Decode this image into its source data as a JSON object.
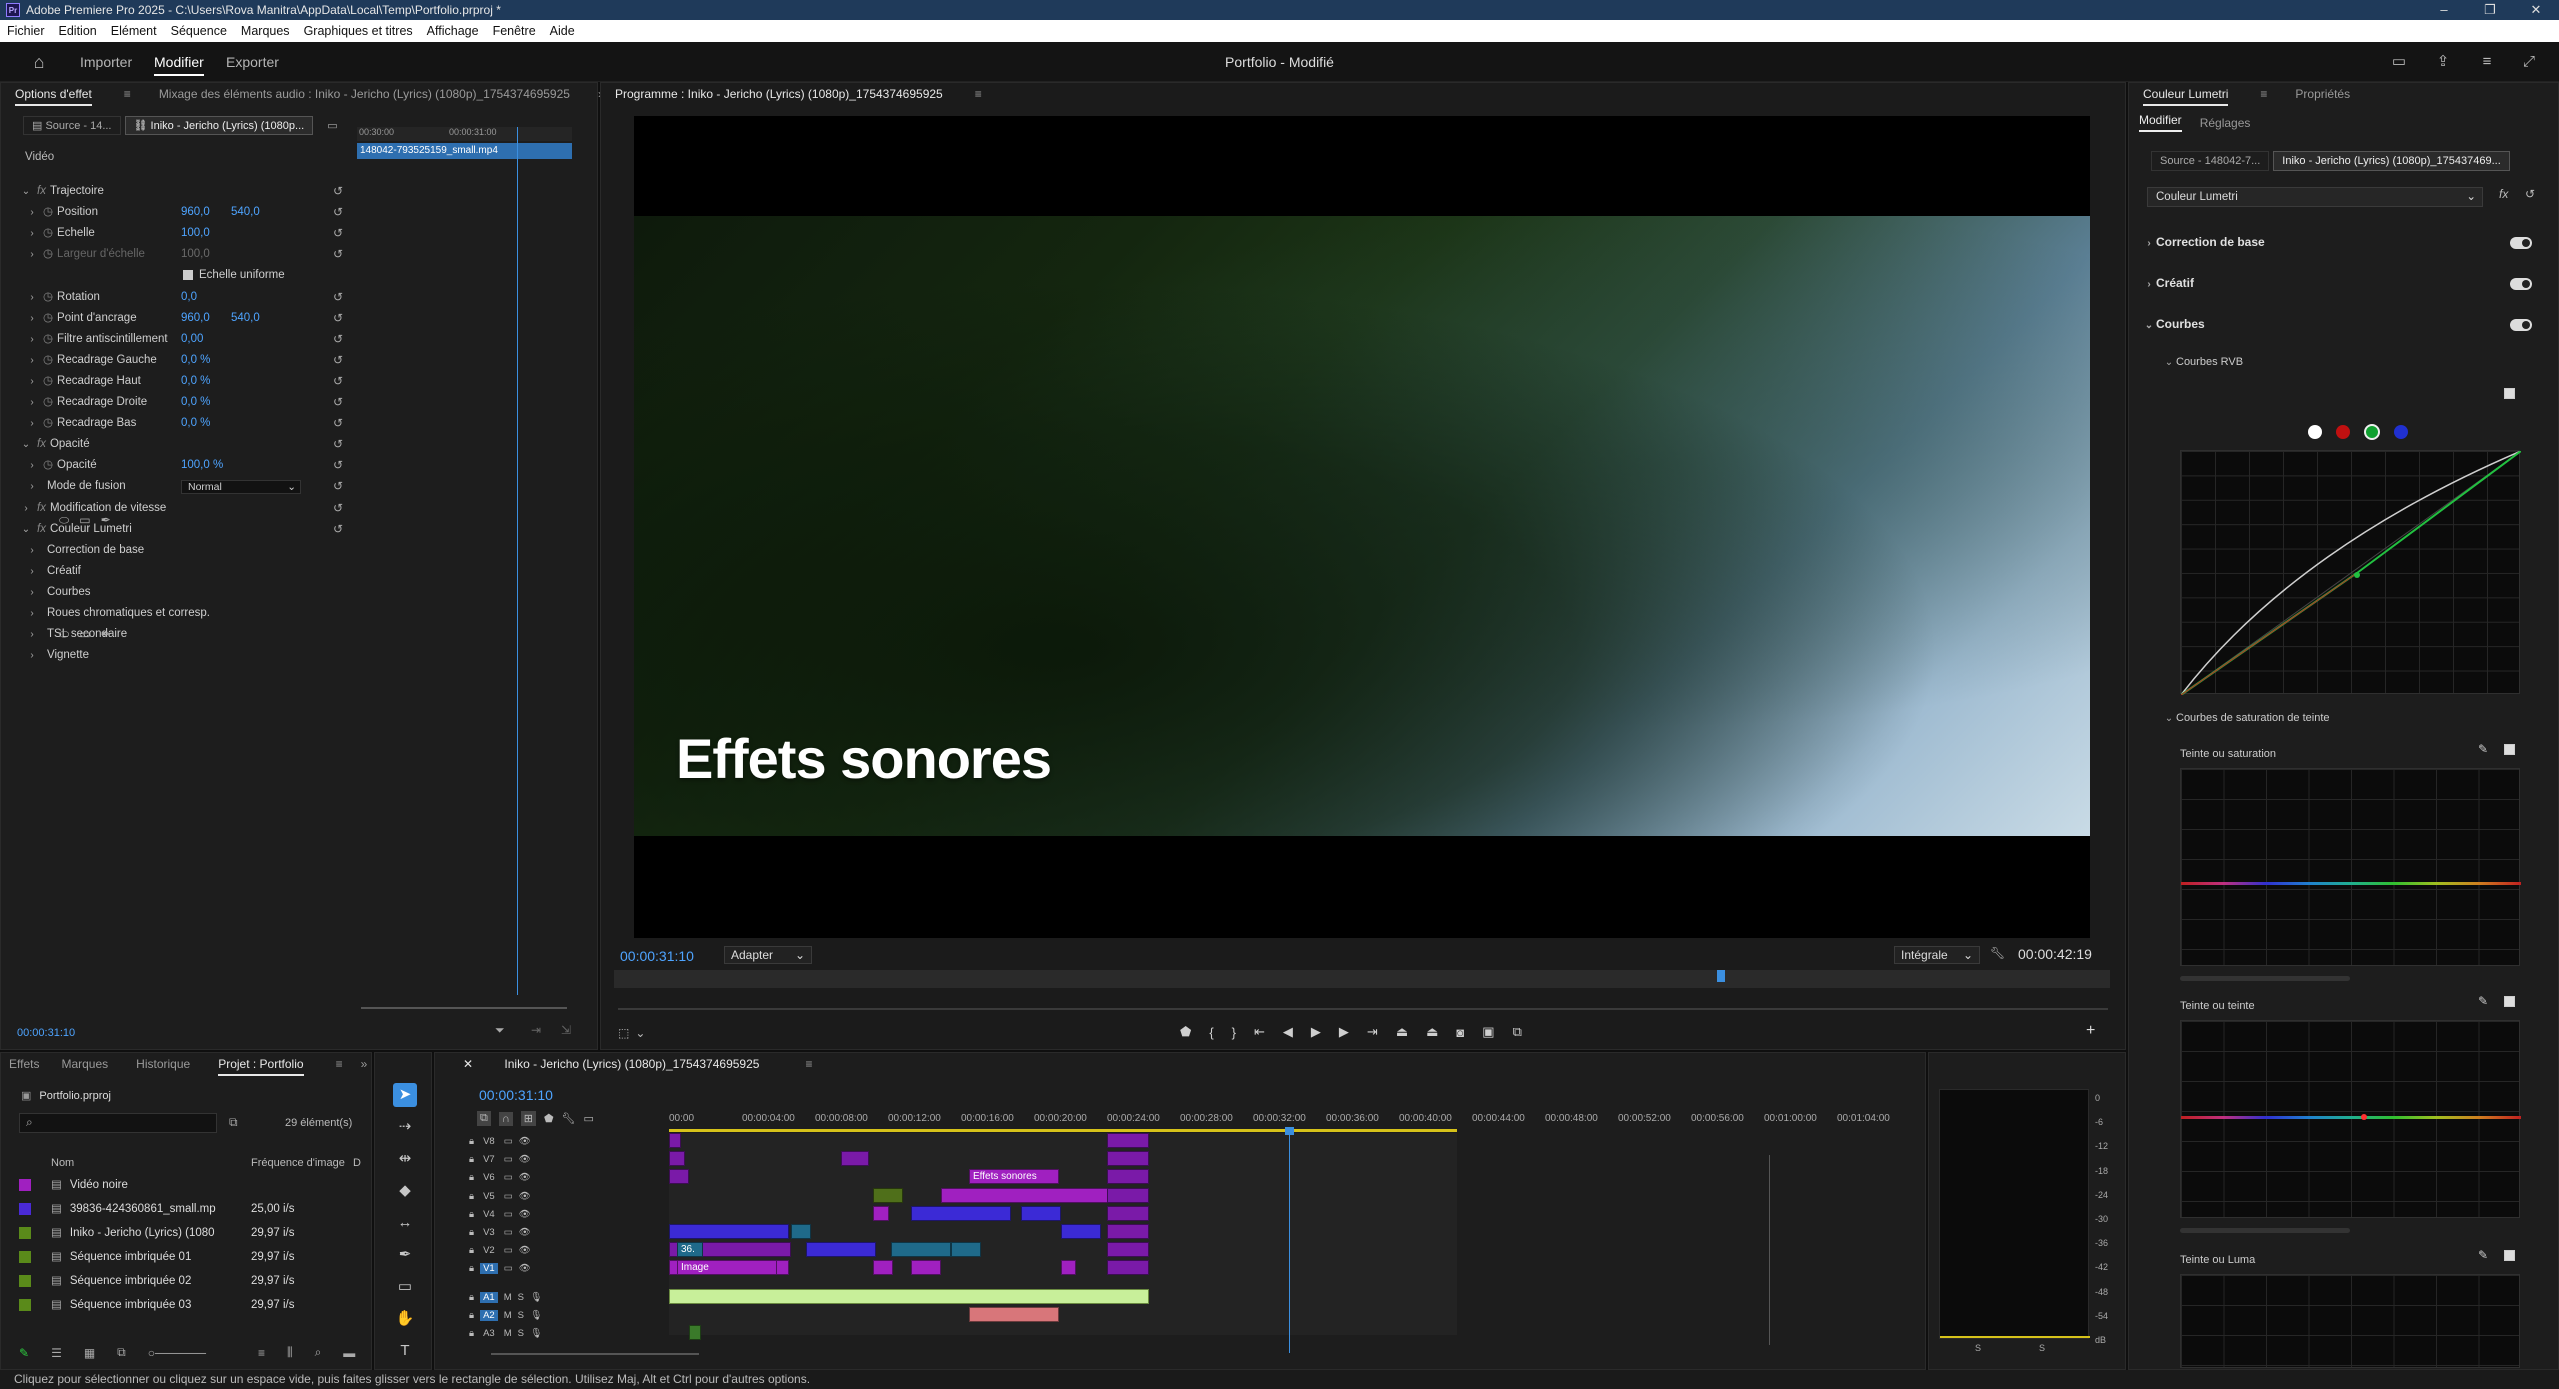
{
  "window": {
    "title": "Adobe Premiere Pro 2025 - C:\\Users\\Rova Manitra\\AppData\\Local\\Temp\\Portfolio.prproj *",
    "app_badge": "Pr"
  },
  "menu": [
    "Fichier",
    "Edition",
    "Elément",
    "Séquence",
    "Marques",
    "Graphiques et titres",
    "Affichage",
    "Fenêtre",
    "Aide"
  ],
  "header": {
    "modes": [
      "Importer",
      "Modifier",
      "Exporter"
    ],
    "active_mode": "Modifier",
    "project_title": "Portfolio - Modifié"
  },
  "effect_controls": {
    "tabs": [
      "Options d'effet",
      "Mixage des éléments audio : Iniko - Jericho (Lyrics) (1080p)_1754374695925"
    ],
    "source_tabs": [
      "Source - 14...",
      "Iniko - Jericho (Lyrics) (1080p..."
    ],
    "mini_timeline": {
      "times": [
        "00:30:00",
        "00:00:31:00"
      ],
      "clip": "148042-793525159_small.mp4"
    },
    "section_video": "Vidéo",
    "rows": [
      {
        "label": "Trajectoire",
        "fx": true,
        "expanded": true
      },
      {
        "label": "Position",
        "v1": "960,0",
        "v2": "540,0"
      },
      {
        "label": "Echelle",
        "v1": "100,0"
      },
      {
        "label": "Largeur d'échelle",
        "v1": "100,0",
        "disabled": true
      },
      {
        "label": "Echelle uniforme",
        "checkbox": true
      },
      {
        "label": "Rotation",
        "v1": "0,0"
      },
      {
        "label": "Point d'ancrage",
        "v1": "960,0",
        "v2": "540,0"
      },
      {
        "label": "Filtre antiscintillement",
        "v1": "0,00"
      },
      {
        "label": "Recadrage Gauche",
        "v1": "0,0 %"
      },
      {
        "label": "Recadrage Haut",
        "v1": "0,0 %"
      },
      {
        "label": "Recadrage Droite",
        "v1": "0,0 %"
      },
      {
        "label": "Recadrage Bas",
        "v1": "0,0 %"
      },
      {
        "label": "Opacité",
        "fx": true,
        "expanded": true
      },
      {
        "label": "Opacité",
        "v1": "100,0 %"
      },
      {
        "label": "Mode de fusion",
        "select": "Normal"
      },
      {
        "label": "Modification de vitesse",
        "fx": true
      },
      {
        "label": "Couleur Lumetri",
        "fx": true,
        "expanded": true
      },
      {
        "label": "Correction de base"
      },
      {
        "label": "Créatif"
      },
      {
        "label": "Courbes"
      },
      {
        "label": "Roues chromatiques et corresp."
      },
      {
        "label": "TSL secondaire"
      },
      {
        "label": "Vignette"
      }
    ],
    "timecode": "00:00:31:10"
  },
  "program": {
    "title": "Programme : Iniko - Jericho (Lyrics) (1080p)_1754374695925",
    "overlay_text": "Effets sonores",
    "timecode": "00:00:31:10",
    "fit": "Adapter",
    "quality": "Intégrale",
    "duration": "00:00:42:19",
    "playhead_fraction": 0.74
  },
  "lumetri": {
    "tabs": [
      "Couleur Lumetri",
      "Propriétés"
    ],
    "subtabs": [
      "Modifier",
      "Réglages"
    ],
    "source_tabs": [
      "Source - 148042-7...",
      "Iniko - Jericho (Lyrics) (1080p)_175437469..."
    ],
    "effect_select": "Couleur Lumetri",
    "sections": [
      "Correction de base",
      "Créatif",
      "Courbes"
    ],
    "curves_rgb": "Courbes RVB",
    "hue_sat_curves": "Courbes de saturation de teinte",
    "graphs": [
      "Teinte ou saturation",
      "Teinte ou teinte",
      "Teinte ou Luma"
    ],
    "channel_colors": [
      "#ffffff",
      "#c01010",
      "#10a030",
      "#2030d0"
    ]
  },
  "project": {
    "tabs": [
      "Effets",
      "Marques",
      "Historique",
      "Projet : Portfolio"
    ],
    "file": "Portfolio.prproj",
    "count": "29 élément(s)",
    "columns": [
      "Nom",
      "Fréquence d'image",
      "D"
    ],
    "items": [
      {
        "name": "Vidéo noire",
        "rate": "",
        "color": "#a020c0"
      },
      {
        "name": "39836-424360861_small.mp",
        "rate": "25,00 i/s",
        "color": "#4a2ad6"
      },
      {
        "name": "Iniko - Jericho (Lyrics) (1080",
        "rate": "29,97 i/s",
        "color": "#5a8a1a"
      },
      {
        "name": "Séquence imbriquée 01",
        "rate": "29,97 i/s",
        "color": "#5a8a1a"
      },
      {
        "name": "Séquence imbriquée 02",
        "rate": "29,97 i/s",
        "color": "#5a8a1a"
      },
      {
        "name": "Séquence imbriquée 03",
        "rate": "29,97 i/s",
        "color": "#5a8a1a"
      }
    ]
  },
  "timeline": {
    "title": "Iniko - Jericho (Lyrics) (1080p)_1754374695925",
    "timecode": "00:00:31:10",
    "ruler": [
      "00:00",
      "00:00:04:00",
      "00:00:08:00",
      "00:00:12:00",
      "00:00:16:00",
      "00:00:20:00",
      "00:00:24:00",
      "00:00:28:00",
      "00:00:32:00",
      "00:00:36:00",
      "00:00:40:00",
      "00:00:44:00",
      "00:00:48:00",
      "00:00:52:00",
      "00:00:56:00",
      "00:01:00:00",
      "00:01:04:00"
    ],
    "video_tracks": [
      "V8",
      "V7",
      "V6",
      "V5",
      "V4",
      "V3",
      "V2",
      "V1"
    ],
    "audio_tracks": [
      "A1",
      "A2",
      "A3"
    ],
    "clip_labels": {
      "effets": "Effets sonores",
      "image": "Image",
      "nested": "36."
    },
    "meter_scale": [
      "0",
      "-6",
      "-12",
      "-18",
      "-24",
      "-30",
      "-36",
      "-42",
      "-48",
      "-54",
      "dB"
    ],
    "meter_channels": [
      "S",
      "S"
    ]
  },
  "status": "Cliquez pour sélectionner ou cliquez sur un espace vide, puis faites glisser vers le rectangle de sélection. Utilisez Maj, Alt et Ctrl pour d'autres options."
}
